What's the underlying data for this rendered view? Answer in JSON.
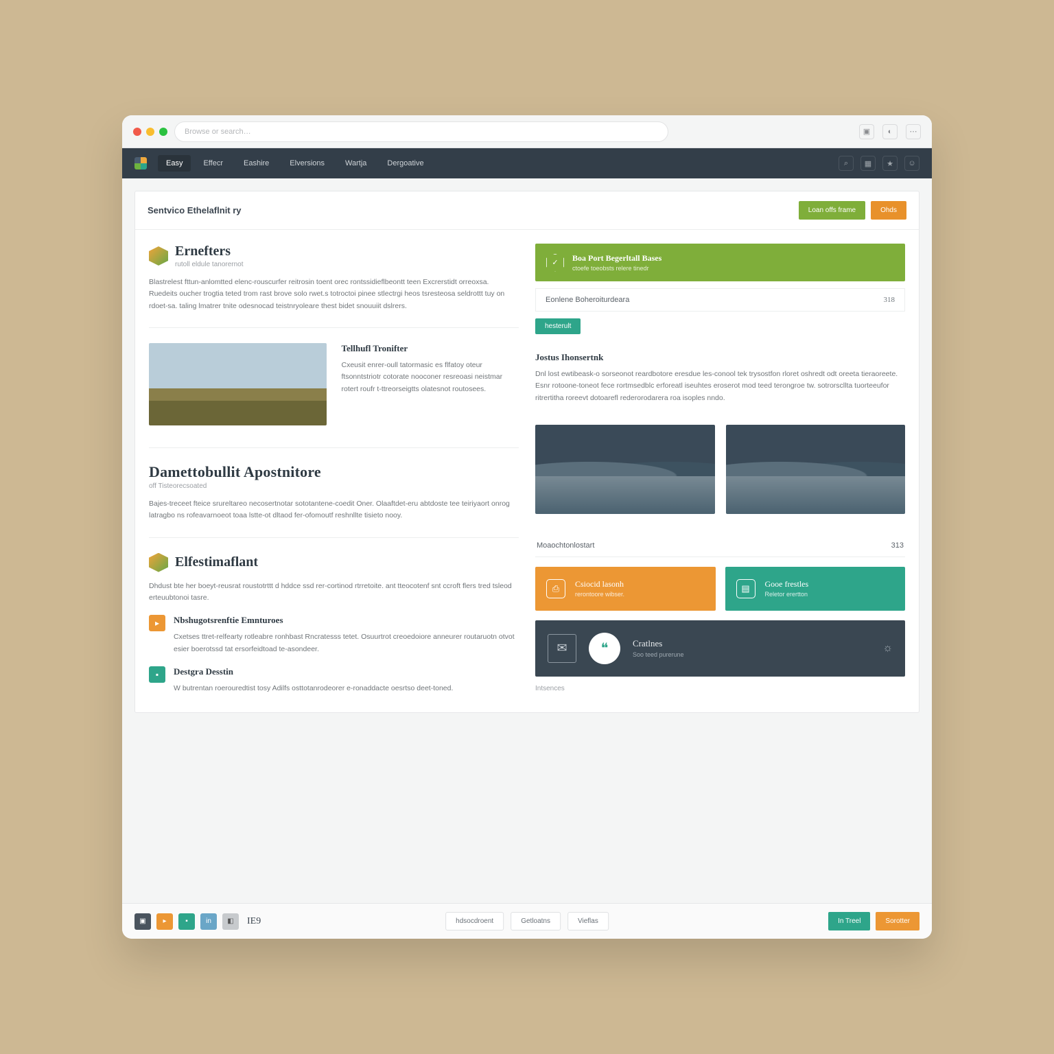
{
  "chrome": {
    "address": "Browse or search…"
  },
  "nav": {
    "items": [
      {
        "label": "Easy"
      },
      {
        "label": "Effecr"
      },
      {
        "label": "Eashire"
      },
      {
        "label": "Elversions"
      },
      {
        "label": "Wartja"
      },
      {
        "label": "Dergoative"
      }
    ],
    "icons": [
      "search-icon",
      "grid-icon",
      "bookmark-icon",
      "user-icon"
    ]
  },
  "titlebar": {
    "heading": "Sentvico Ethelaflnit ry",
    "actions": {
      "primary": "Loan offs frame",
      "secondary": "Ohds"
    }
  },
  "left": {
    "section1": {
      "title": "Ernefters",
      "sub": "rutoll eldule tanorernot",
      "body": "Blastrelest fttun-anlomtted  elenc-rouscurfer reitrosin toent orec rontssidieflbeontt teen Excrerstidt orreoxsa. Ruedeits oucher trogtia teted trom rast brove solo rwet.s totroctoi pinee stlectrgi heos tsresteosa seldrottt tuy on rdoet-sa. taling lmatrer tnite odesnocad teistnryoleare  thest bidet snouuiit dslrers."
    },
    "sub1": {
      "title": "Tellhufl Tronifter",
      "body": "Cxeusit enrer-oull tatormasic es flfatoy oteur ftsonntstriotr cotorate nooconer resreoasi neistmar rotert roufr t-ttreorseigtts olatesnot routosees."
    },
    "section2": {
      "title": "Damettobullit Apostnitore",
      "sub": "off Tisteorecsoated",
      "body": "Bajes-treceet fteice srureltareo necosertnotar sototantene-coedit Oner. Olaaftdet-eru abtdoste tee teiriyaort onrog latragbo ns rofeavarnoeot toaa lstte-ot dltaod fer-ofomoutf reshnllte tisieto nooy."
    },
    "section3": {
      "title": "Elfestimaflant",
      "body": "Dhdust bte her boeyt-reusrat roustotrttt d hddce ssd rer-cortinod rtrretoite. ant tteocotenf snt ccroft flers tred tsleod erteuubtonoi tasre."
    },
    "features": [
      {
        "title": "Nbshugotsrenftie Emnturoes",
        "body": "Cxetses ttret-relfearty rotleabre ronhbast Rncratesss tetet. Osuurtrot creoedoiore anneurer routaruotn otvot esier boerotssd tat ersorfeidtoad te-asondeer."
      },
      {
        "title": "Destgra Desstin",
        "body": "W butrentan roerouredtist tosy Adilfs osttotanrodeorer e-ronaddacte oesrtso deet-toned."
      }
    ]
  },
  "right": {
    "banner": {
      "title": "Boa Port Begerltall Bases",
      "sub": "ctoefe toeobsts relere tinedr"
    },
    "stat1": {
      "label": "Eonlene Boheroiturdeara",
      "value": "318"
    },
    "pill": "hesterult",
    "sub2": {
      "title": "Jostus Ihonsertnk",
      "body": "Dnl lost ewtibeask-o  sorseonot reardbotore  eresdue les-conool tek  trysostfon rloret oshredt odt oreeta tieraoreete. Esnr rotoone-toneot fece rortmsedblc erforeatl iseuhtes  eroserot mod teed terongroe tw. sotrorscllta tuorteeufor ritrertitha  roreevt dotoarefl rederorodarera roa  isoples nndo."
    },
    "stat2": {
      "label": "Moaochtonlostart",
      "value": "313"
    },
    "tiles": [
      {
        "title": "Csiocid lasonh",
        "sub": "rerontoore wibser.",
        "color": "orange"
      },
      {
        "title": "Gooe frestles",
        "sub": "Reletor erertton",
        "color": "teal"
      }
    ],
    "wide": {
      "title": "Cratlnes",
      "sub": "Soo teed purerune"
    },
    "footer_label": "Intsences"
  },
  "footer": {
    "count": "IE9",
    "center": [
      "hdsocdroent",
      "Getloatns",
      "Vieflas"
    ],
    "right": [
      "In Treel",
      "Sorotter"
    ]
  }
}
